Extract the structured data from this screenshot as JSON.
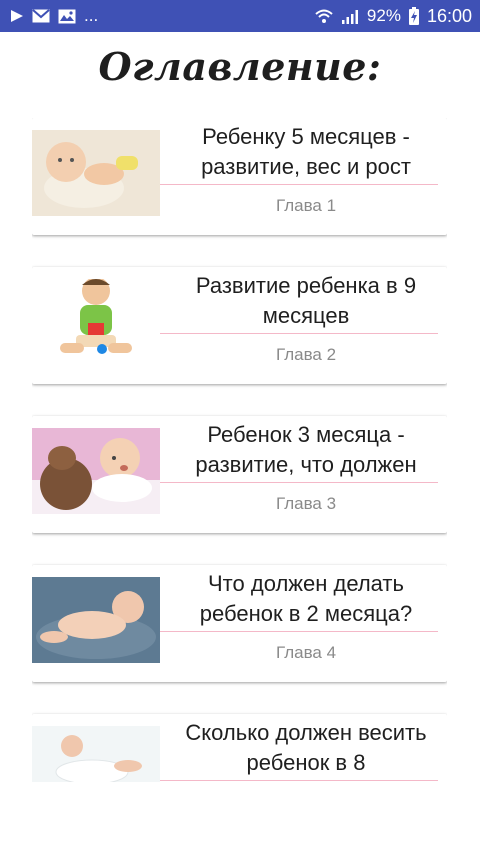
{
  "status_bar": {
    "battery": "92%",
    "time": "16:00",
    "overflow": "..."
  },
  "page": {
    "title": "Оглавление:"
  },
  "items": [
    {
      "title": "Ребенку 5 месяцев - развитие, вес и рост",
      "chapter": "Глава 1"
    },
    {
      "title": "Развитие ребенка в 9 месяцев",
      "chapter": "Глава 2"
    },
    {
      "title": "Ребенок 3 месяца - развитие, что должен",
      "chapter": "Глава 3"
    },
    {
      "title": "Что должен делать ребенок в 2 месяца?",
      "chapter": "Глава 4"
    },
    {
      "title": "Сколько должен весить ребенок в 8",
      "chapter": ""
    }
  ],
  "colors": {
    "status_bar": "#3f51b5",
    "divider": "#f4b8c8",
    "chapter_text": "#8a8a8a"
  }
}
